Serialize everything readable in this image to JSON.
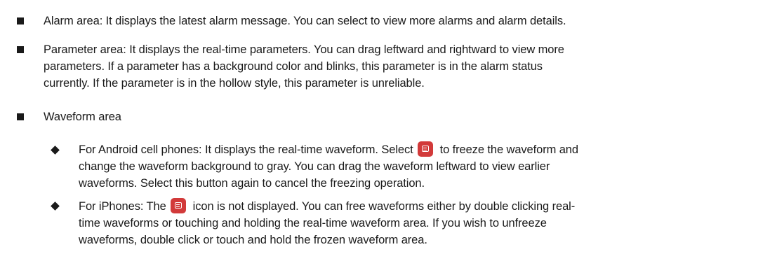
{
  "items": [
    {
      "lines": [
        "Alarm area: It displays the latest alarm message. You can select to view more alarms and alarm details."
      ]
    },
    {
      "lines": [
        "Parameter area: It displays the real-time parameters. You can drag leftward and rightward to view more",
        "parameters. If a parameter has a background color and blinks, this parameter is in the alarm status",
        "currently. If the parameter is in the hollow style, this parameter is unreliable."
      ]
    },
    {
      "lines": [
        "Waveform area"
      ]
    }
  ],
  "subitems": [
    {
      "line1_before_icon": "For Android cell phones: It displays the real-time waveform. Select",
      "line1_after_icon": "to freeze the waveform and",
      "lines": [
        "change the waveform background to gray. You can drag the waveform leftward to view earlier",
        "waveforms. Select this button again to cancel the freezing operation."
      ],
      "icon": "freeze-waveform-icon"
    },
    {
      "line1_before_icon": "For iPhones: The",
      "line1_after_icon": "icon is not displayed. You can free waveforms either by double clicking real-",
      "lines": [
        "time waveforms or touching and holding the real-time waveform area. If you wish to unfreeze",
        "waveforms, double click or touch and hold the frozen waveform area."
      ],
      "icon": "freeze-waveform-icon"
    }
  ],
  "colors": {
    "text": "#1a1a1a",
    "icon_background": "#d23a3a"
  }
}
